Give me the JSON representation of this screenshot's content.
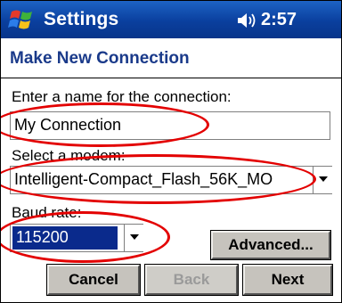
{
  "titlebar": {
    "title": "Settings",
    "time": "2:57"
  },
  "header": {
    "title": "Make New Connection"
  },
  "form": {
    "name_label": "Enter a name for the connection:",
    "name_value": "My Connection",
    "modem_label": "Select a modem:",
    "modem_value": "Intelligent-Compact_Flash_56K_MO",
    "baud_label": "Baud rate:",
    "baud_value": "115200"
  },
  "buttons": {
    "advanced": "Advanced...",
    "cancel": "Cancel",
    "back": "Back",
    "next": "Next"
  },
  "colors": {
    "titlebar": "#0a3f9e",
    "highlight_circle": "#e30000",
    "selection": "#0a2a8c"
  }
}
